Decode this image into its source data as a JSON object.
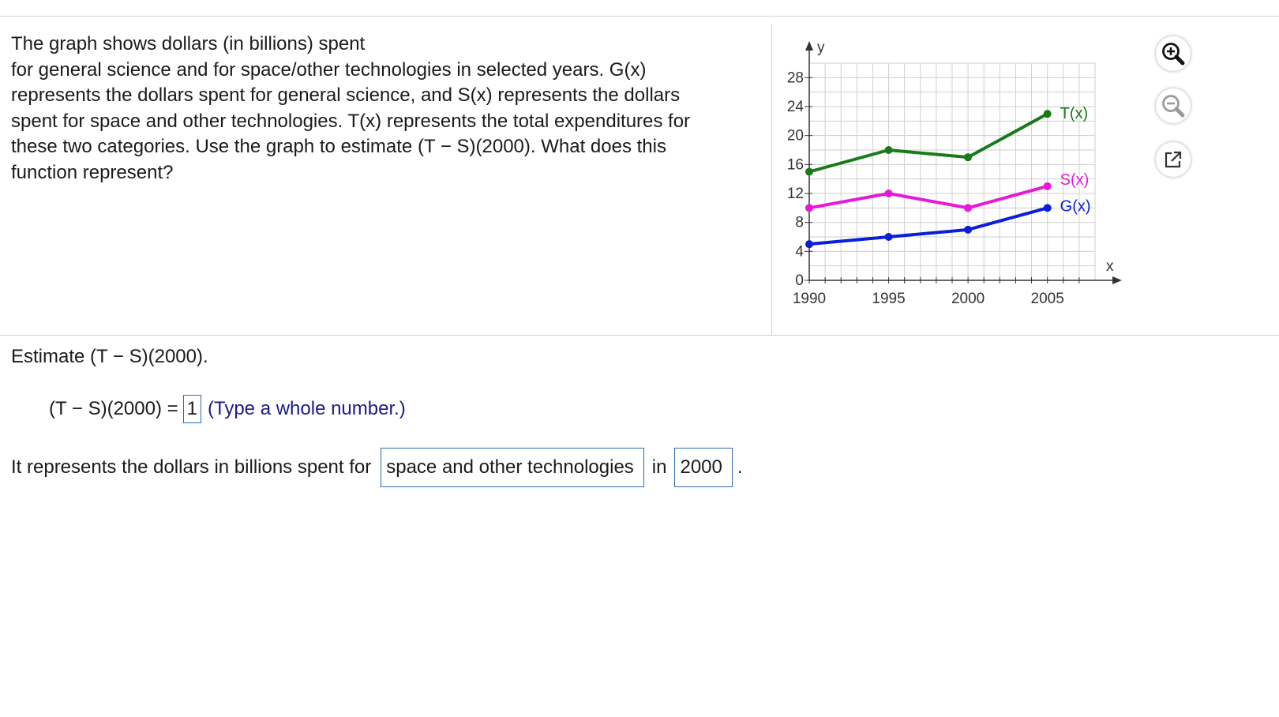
{
  "question": {
    "lines": [
      "The graph shows dollars (in billions) spent",
      "for general science and for space/other technologies in selected years. G(x)",
      "represents the dollars spent for general science, and S(x) represents the dollars",
      "spent for space and other technologies. T(x) represents the total expenditures for",
      "these two categories. Use the graph to estimate (T − S)(2000). What does this",
      "function represent?"
    ]
  },
  "tools": {
    "zoom_in": "zoom-in-icon",
    "zoom_out": "zoom-out-icon",
    "popout": "popout-icon"
  },
  "chart_data": {
    "type": "line",
    "x": [
      1990,
      1995,
      2000,
      2005
    ],
    "xticks": [
      "1990",
      "1995",
      "2000",
      "2005"
    ],
    "yticks": [
      "0",
      "4",
      "8",
      "12",
      "16",
      "20",
      "24",
      "28"
    ],
    "xlim": [
      1990,
      2008
    ],
    "ylim": [
      0,
      30
    ],
    "xlabel": "x",
    "ylabel": "y",
    "grid": true,
    "series": [
      {
        "name": "T(x)",
        "values": [
          15,
          18,
          17,
          23
        ],
        "color": "#1a7a1a"
      },
      {
        "name": "S(x)",
        "values": [
          10,
          12,
          10,
          13
        ],
        "color": "#e619d9"
      },
      {
        "name": "G(x)",
        "values": [
          5,
          6,
          7,
          10
        ],
        "color": "#0a1fd6"
      }
    ]
  },
  "part1": {
    "label": "Estimate (T − S)(2000).",
    "expression": "(T − S)(2000) =",
    "answer": "1",
    "hint": "(Type a whole number.)"
  },
  "part2": {
    "prefix": "It represents the dollars in billions spent for",
    "dropdown1": "space and other technologies",
    "middle": "in",
    "dropdown2": "2000",
    "suffix": "."
  }
}
